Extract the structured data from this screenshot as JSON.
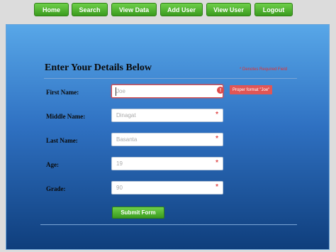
{
  "nav": [
    {
      "label": "Home"
    },
    {
      "label": "Search"
    },
    {
      "label": "View Data"
    },
    {
      "label": "Add User"
    },
    {
      "label": "View User"
    },
    {
      "label": "Logout"
    }
  ],
  "form": {
    "title": "Enter Your Details Below",
    "required_note": "* Denotes Required Field",
    "fields": [
      {
        "label": "First Name:",
        "value": "Joe",
        "required": "",
        "error_tooltip": "Proper format \"Joe\""
      },
      {
        "label": "Middle Name:",
        "value": "Dinagat",
        "required": "*"
      },
      {
        "label": "Last Name:",
        "value": "Basanta",
        "required": "*"
      },
      {
        "label": "Age:",
        "value": "19",
        "required": "*"
      },
      {
        "label": "Grade:",
        "value": "90",
        "required": "*"
      }
    ],
    "error_icon": "!",
    "submit_label": "Submit Form"
  },
  "colors": {
    "nav_green": "#3a9b1e",
    "panel_top": "#58a7e8",
    "panel_bottom": "#0f3e7c",
    "error_red": "#e04a4a"
  }
}
